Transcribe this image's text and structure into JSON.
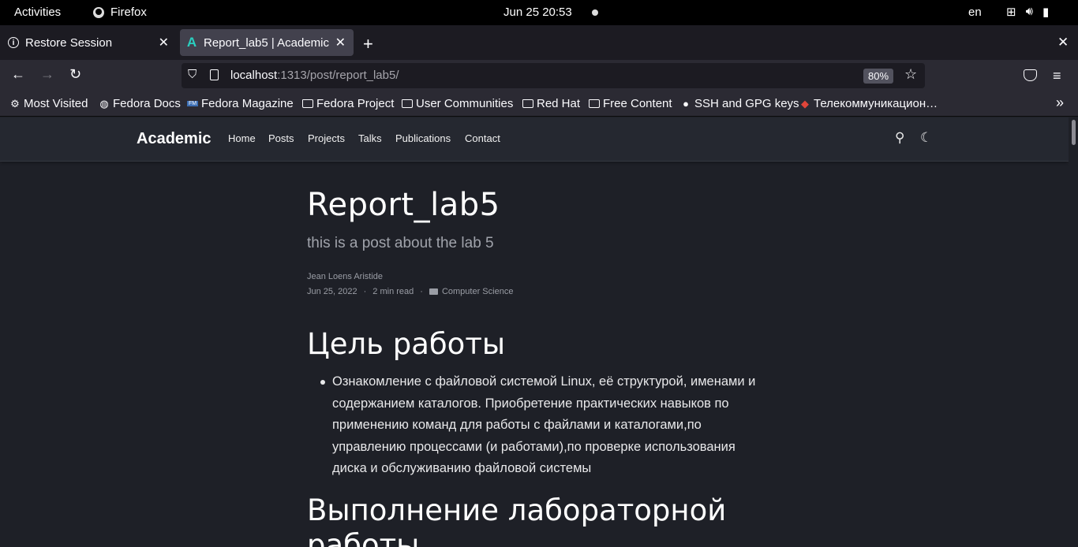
{
  "system_bar": {
    "activities": "Activities",
    "app_name": "Firefox",
    "clock": "Jun 25  20:53",
    "language": "en"
  },
  "browser": {
    "tabs": [
      {
        "title": "Restore Session",
        "active": false,
        "icon": "info-icon"
      },
      {
        "title": "Report_lab5 | Academic",
        "active": true,
        "icon": "academic-favicon"
      }
    ],
    "url": {
      "host": "localhost",
      "rest": ":1313/post/report_lab5/"
    },
    "zoom": "80%",
    "bookmarks": [
      {
        "label": "Most Visited",
        "icon": "gear-icon"
      },
      {
        "label": "Fedora Docs",
        "icon": "globe-icon"
      },
      {
        "label": "Fedora Magazine",
        "icon": "fm-icon"
      },
      {
        "label": "Fedora Project",
        "icon": "folder-icon"
      },
      {
        "label": "User Communities",
        "icon": "folder-icon"
      },
      {
        "label": "Red Hat",
        "icon": "folder-icon"
      },
      {
        "label": "Free Content",
        "icon": "folder-icon"
      },
      {
        "label": "SSH and GPG keys",
        "icon": "github-icon"
      },
      {
        "label": "Телекоммуникацион…",
        "icon": "telecom-icon"
      }
    ]
  },
  "site": {
    "brand": "Academic",
    "nav": [
      "Home",
      "Posts",
      "Projects",
      "Talks",
      "Publications",
      "Contact"
    ]
  },
  "article": {
    "title": "Report_lab5",
    "subtitle": "this is a post about the lab 5",
    "author": "Jean Loens Aristide",
    "date": "Jun 25, 2022",
    "read_time": "2 min read",
    "category": "Computer Science",
    "sections": [
      {
        "heading": "Цель работы",
        "bullets": [
          "Ознакомление с файловой системой Linux, её структурой, именами и содержанием каталогов. Приобретение практических навыков по применению команд для работы с файлами и каталогами,по управлению процессами (и работами),по проверке использования диска и обслуживанию файловой системы"
        ]
      },
      {
        "heading": "Выполнение лабораторной работы"
      }
    ]
  },
  "colors": {
    "page_bg": "#1e2027",
    "site_nav_bg": "#252830",
    "browser_chrome": "#2b2a33",
    "accent_favicon": "#2ad0c0"
  }
}
